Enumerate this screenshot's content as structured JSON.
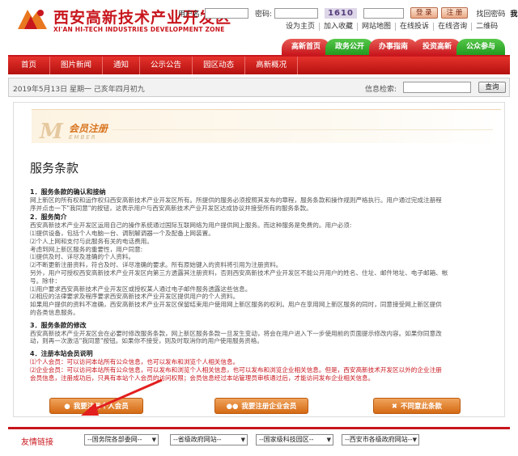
{
  "header": {
    "logo_cn": "西安高新技术产业开发区",
    "logo_en": "XI'AN HI-TECH INDUSTRIES DEVELOPMENT ZONE",
    "username_label": "用户名:",
    "password_label": "密码:",
    "captcha": "1610",
    "login_button": "登 录",
    "register_button": "注 册",
    "forgot_password": "找回密码",
    "my_desk": "我的助手"
  },
  "toplinks": [
    "设为主页",
    "加入收藏",
    "网站地图",
    "在线投诉",
    "在线咨询",
    "二维码"
  ],
  "tabs": [
    {
      "label": "高新首页",
      "color": "#c8161d"
    },
    {
      "label": "政务公开",
      "color": "#2a9e22"
    },
    {
      "label": "办事指南",
      "color": "#c8161d"
    },
    {
      "label": "投资高新",
      "color": "#c8161d"
    },
    {
      "label": "公众参与",
      "color": "#2a9e22"
    }
  ],
  "nav": [
    "首页",
    "图片新闻",
    "通知",
    "公示公告",
    "园区动态",
    "高新概况"
  ],
  "info": {
    "date": "2019年5月13日  星期一  己亥年四月初九",
    "search_label": "信息检索:",
    "search_button": "查询"
  },
  "banner": {
    "letter": "M",
    "title": "会员注册",
    "subtitle": "EMBER"
  },
  "page_title": "服务条款",
  "sections": [
    {
      "heading": "1．服务条款的确认和接纳",
      "lines": [
        "网上新区的所有权和运作权归西安高新技术产业开发区所有。所提供的服务必须按照其发布的章程，服务条款和操作规则严格执行。用户通过完成注册程",
        "序并点击一下\"我同意\"的按钮，这表示用户与西安高新技术产业开发区达成协议并接受所有的服务条款。"
      ]
    },
    {
      "heading": "2．服务简介",
      "lines": [
        "西安高新技术产业开发区运用自己的操作系统通过国际互联网络为用户提供网上服务。而这种服务是免费的。用户必须:",
        "⑴提供设备，包括个人电脑一台、调制解调器一个及配备上网装置。",
        "⑵个人上网和支付与此服务有关的电话费用。",
        "考虑到网上新区服务的重要性，用户同意:",
        "⑴提供及时、详尽及准确的个人资料。",
        "⑵不断更新注册资料，符合及时、详尽准确的要求。所有原始键入的资料将引用为注册资料。",
        "另外，用户可授权西安高新技术产业开发区向第三方透露其注册资料，否则西安高新技术产业开发区不能公开用户的姓名、住址、邮件地址、电子邮箱、帐",
        "号。除非：",
        "⑴用户要求西安高新技术产业开发区或授权某人通过电子邮件服务透露这些信息。",
        "⑵相应的法律要求及程序要求西安高新技术产业开发区提供用户的个人资料。",
        "如果用户提供的资料不准确，西安高新技术产业开发区保留结束用户使用网上新区服务的权利。用户在享用网上新区服务的同时，同意接受网上新区提供",
        "的各类信息服务。"
      ]
    },
    {
      "heading": "3．服务条款的修改",
      "lines": [
        "西安高新技术产业开发区会在必要时修改服务条款，网上新区服务条款一旦发生变动，将会在用户进入下一步使用前的页面提示修改内容。如果你同意改",
        "动，则再一次激活\"我同意\"按钮。如果你不接受，则及时取消你的用户使用服务资格。"
      ]
    },
    {
      "heading": "4．注册本站会员说明",
      "lines": [
        "⑴个人会员：可以访问本站所有公众信息，也可以发布和浏览个人相关信息。",
        "⑵企业会员：可以访问本站所有公众信息，可以发布和浏览个人相关信息，也可以发布和浏览企业相关信息。但是，西安高新技术开发区以外的企业注册",
        "会员信息，注册成功后，只具有本站个人会员的访问权限；会员信息经过本站管理员审核通过后，才能访问发布企业相关信息。"
      ]
    }
  ],
  "buttons": {
    "personal": "我要注册个人会员",
    "enterprise": "我要注册企业会员",
    "disagree": "不同意此条款"
  },
  "friends": {
    "label": "友情链接",
    "selects": [
      "--国务院各部委网--",
      "--省级政府网站--",
      "--国家级科技园区--",
      "--西安市各级政府网站--"
    ]
  }
}
